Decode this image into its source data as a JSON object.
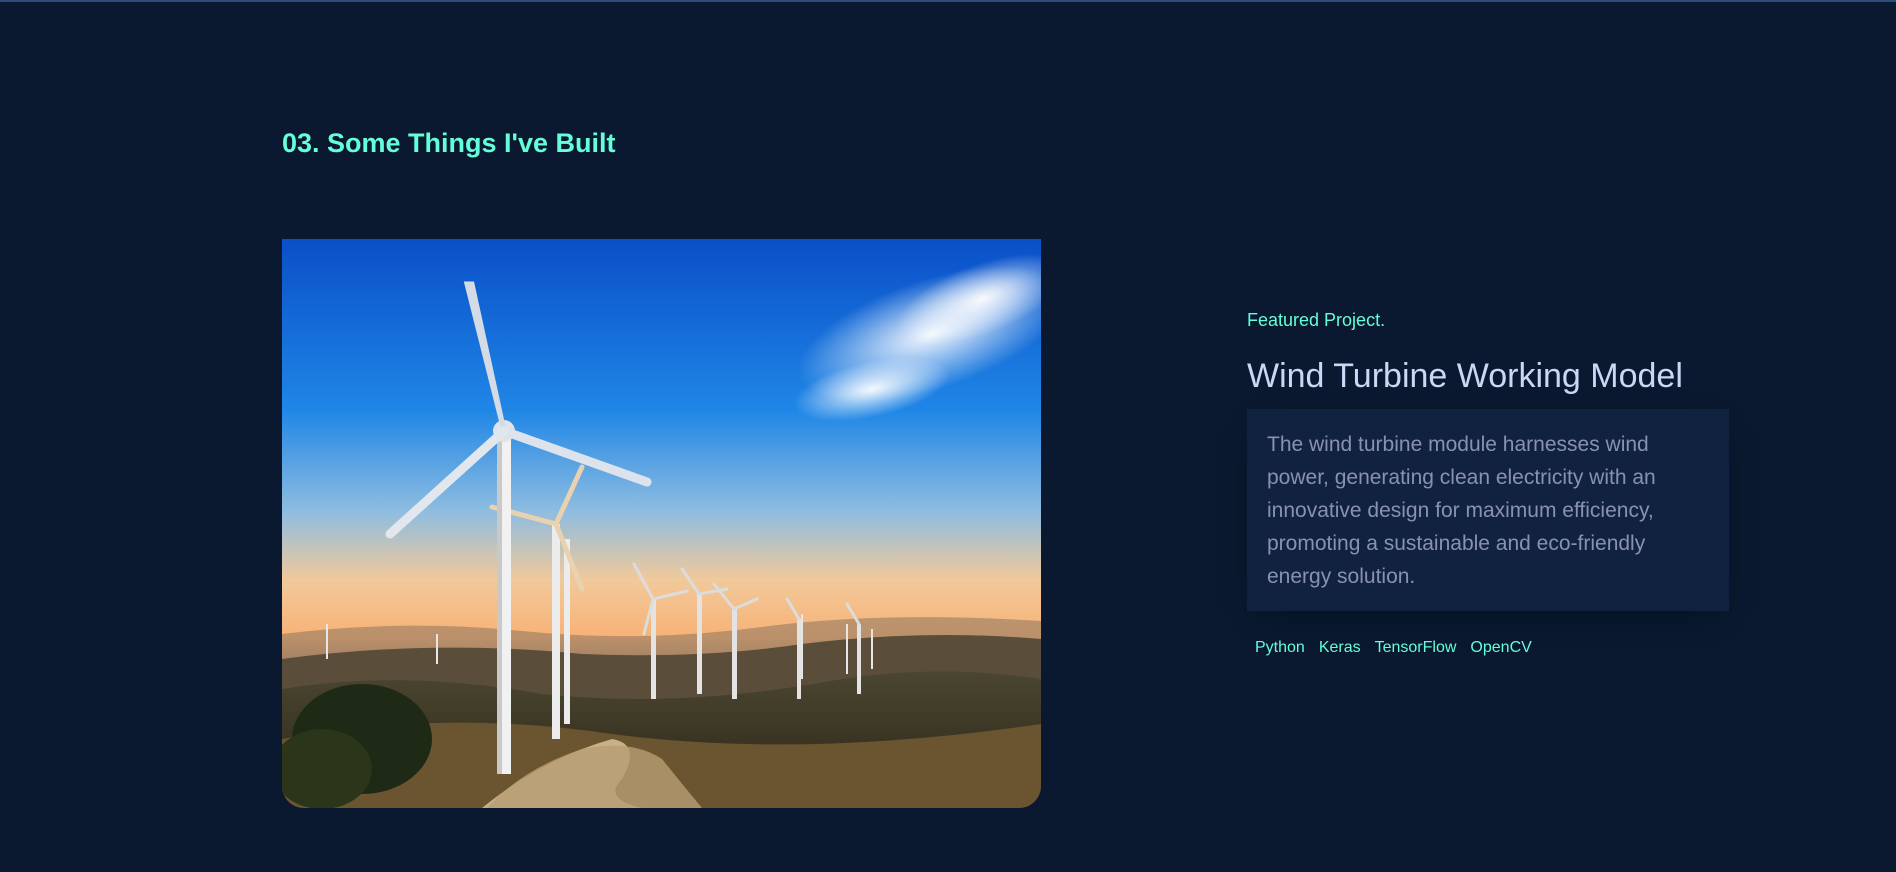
{
  "section": {
    "title": "03. Some Things I've Built"
  },
  "project": {
    "overline": "Featured Project.",
    "title": "Wind Turbine Working Model",
    "description": "The wind turbine module harnesses wind power, generating clean electricity with an innovative design for maximum efficiency, promoting a sustainable and eco-friendly energy solution.",
    "image_subject": "wind turbines on hills at sunset",
    "tech": [
      "Python",
      "Keras",
      "TensorFlow",
      "OpenCV"
    ]
  },
  "colors": {
    "background": "#0a192f",
    "accent": "#64ffda",
    "heading": "#ccd6f6",
    "body_text": "#8892b0",
    "card": "#112240"
  }
}
